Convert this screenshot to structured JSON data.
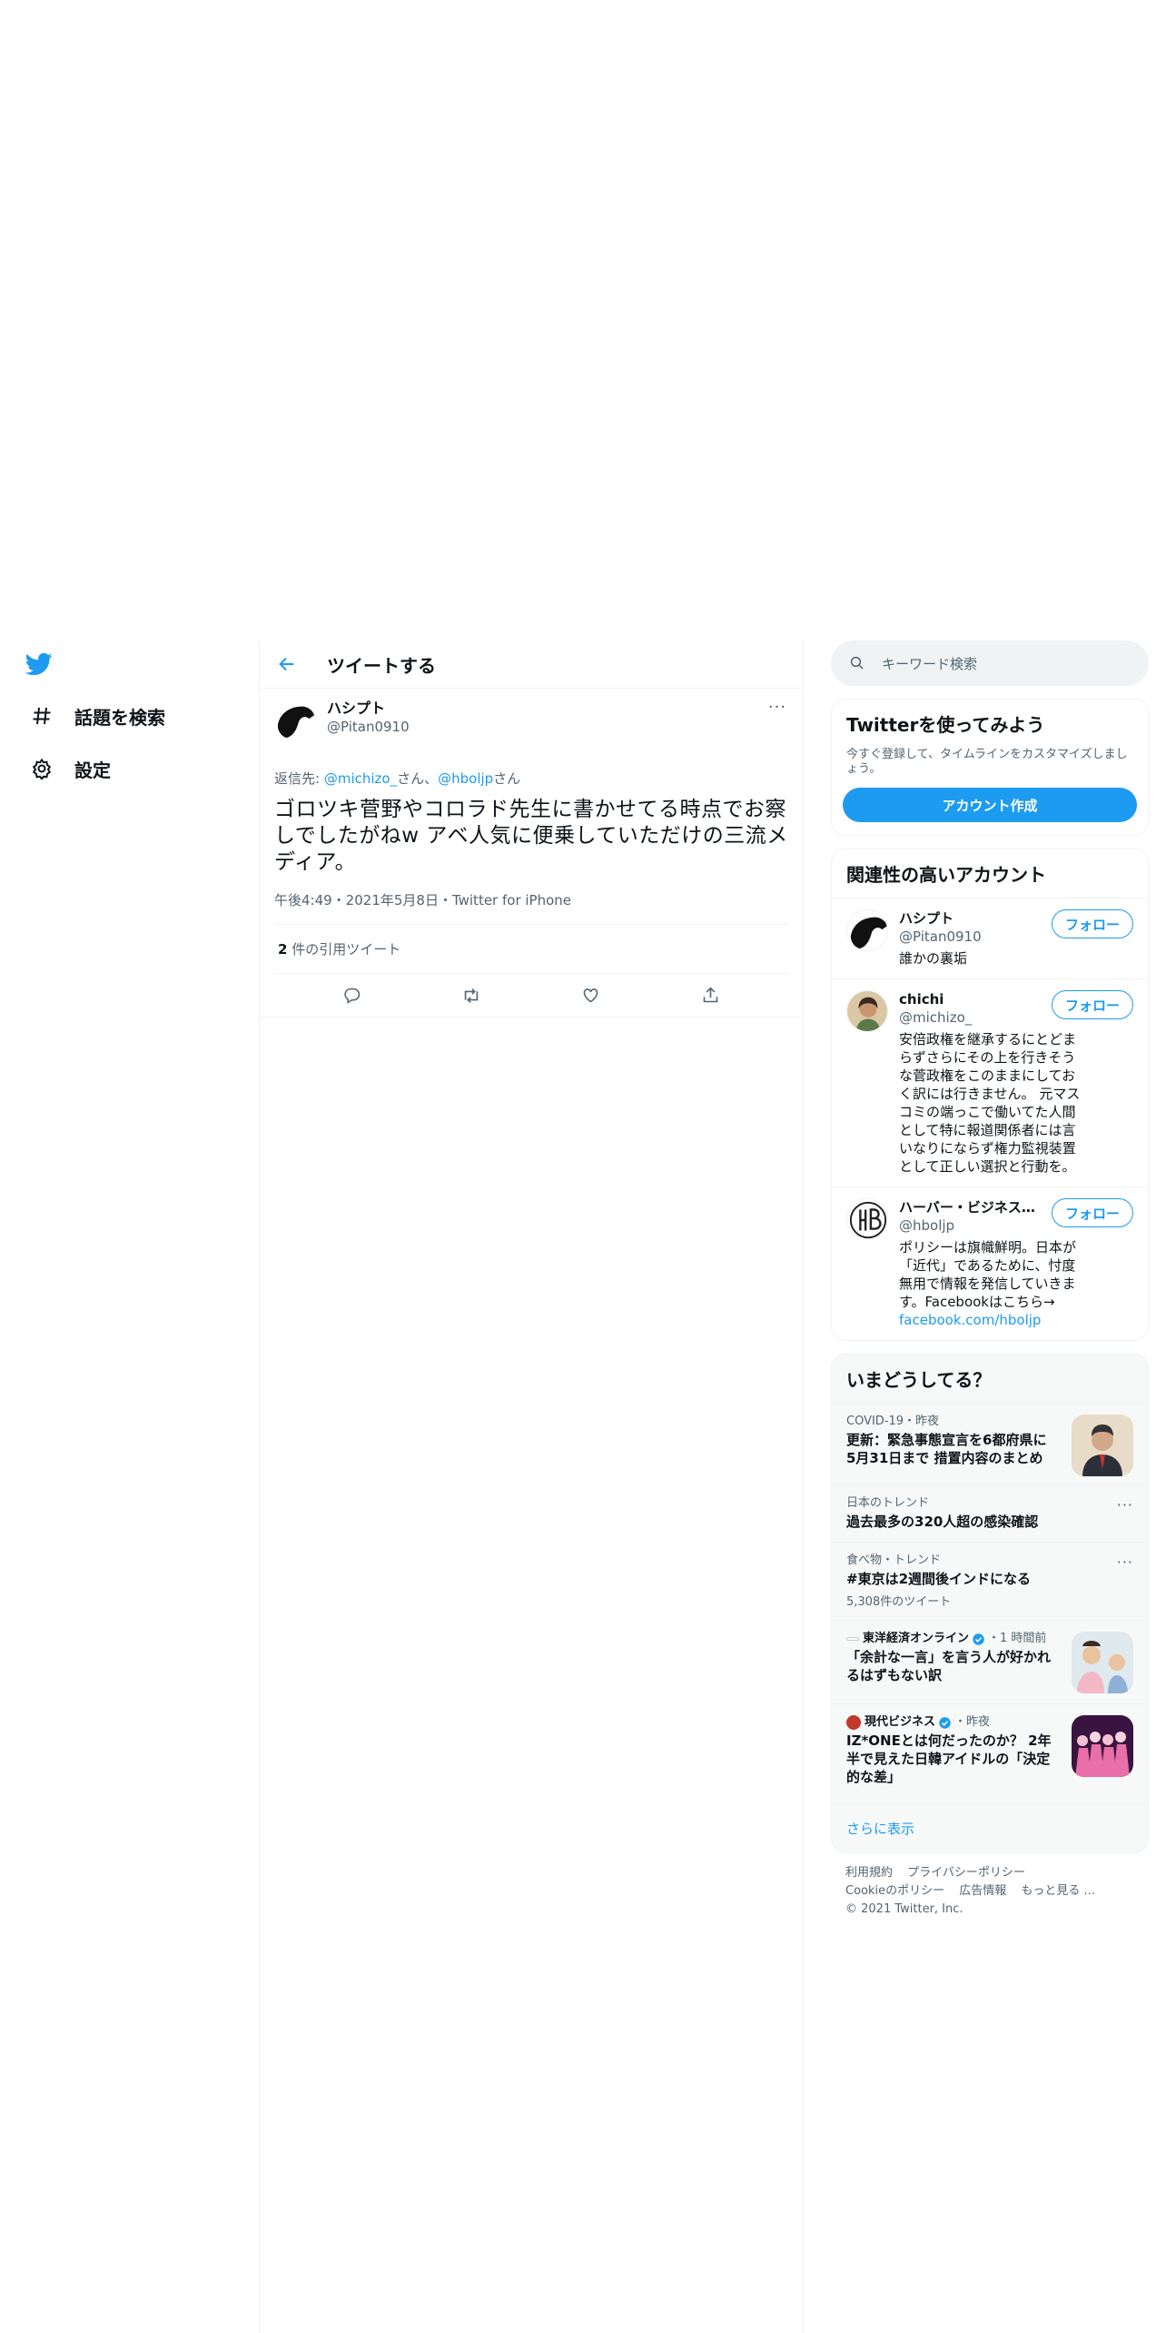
{
  "nav": {
    "items": [
      {
        "label": "話題を検索",
        "icon": "hashtag-icon"
      },
      {
        "label": "設定",
        "icon": "gear-icon"
      }
    ]
  },
  "header": {
    "title": "ツイートする"
  },
  "tweet": {
    "author_name": "ハシプト",
    "author_handle": "@Pitan0910",
    "reply_prefix": "返信先: ",
    "reply_mention1": "@michizo_",
    "reply_sep1": "さん、",
    "reply_mention2": "@hboljp",
    "reply_sep2": "さん",
    "text": "ゴロツキ菅野やコロラド先生に書かせてる時点でお察しでしたがねw アベ人気に便乗していただけの三流メディア。",
    "meta": "午後4:49・2021年5月8日・Twitter for iPhone",
    "quote_count": "2",
    "quote_label": " 件の引用ツイート"
  },
  "search": {
    "placeholder": "キーワード検索"
  },
  "signup": {
    "title": "Twitterを使ってみよう",
    "desc": "今すぐ登録して、タイムラインをカスタマイズしましょう。",
    "button": "アカウント作成"
  },
  "relevant": {
    "title": "関連性の高いアカウント",
    "follow_label": "フォロー",
    "accounts": [
      {
        "name": "ハシプト",
        "handle": "@Pitan0910",
        "bio": "誰かの裏垢",
        "link": ""
      },
      {
        "name": "chichi",
        "handle": "@michizo_",
        "bio": "安倍政権を継承するにとどまらずさらにその上を行きそうな菅政権をこのままにしておく訳には行きません。 元マスコミの端っこで働いてた人間として特に報道関係者には言いなりにならず権力監視装置として正しい選択と行動を。",
        "link": ""
      },
      {
        "name": "ハーバー・ビジネス・オンライン",
        "handle": "@hboljp",
        "bio": "ポリシーは旗幟鮮明。日本が「近代」であるために、忖度無用で情報を発信していきます。Facebookはこちら→",
        "link": "facebook.com/hboljp"
      }
    ]
  },
  "trends": {
    "title": "いまどうしてる？",
    "items": [
      {
        "meta": "COVID-19・昨夜",
        "title": "更新：緊急事態宣言を6都府県に5月31日まで 措置内容のまとめ",
        "count": ""
      },
      {
        "meta": "日本のトレンド",
        "title": "過去最多の320人超の感染確認",
        "count": ""
      },
      {
        "meta": "食べ物・トレンド",
        "title": "#東京は2週間後インドになる",
        "count": "5,308件のツイート"
      },
      {
        "meta_source": "東洋経済オンライン",
        "meta_time": "・1 時間前",
        "title": "「余計な一言」を言う人が好かれるはずもない訳",
        "count": ""
      },
      {
        "meta_source": "現代ビジネス",
        "meta_time": "・昨夜",
        "title": "IZ*ONEとは何だったのか？ 2年半で見えた日韓アイドルの「決定的な差」",
        "count": ""
      }
    ],
    "show_more": "さらに表示"
  },
  "footer": {
    "links": [
      "利用規約",
      "プライバシーポリシー",
      "Cookieのポリシー",
      "広告情報",
      "もっと見る ..."
    ],
    "copyright": "© 2021 Twitter, Inc."
  },
  "colors": {
    "accent": "#1d9bf0",
    "text": "#0f1419",
    "muted": "#536471",
    "border": "#eff3f4"
  }
}
